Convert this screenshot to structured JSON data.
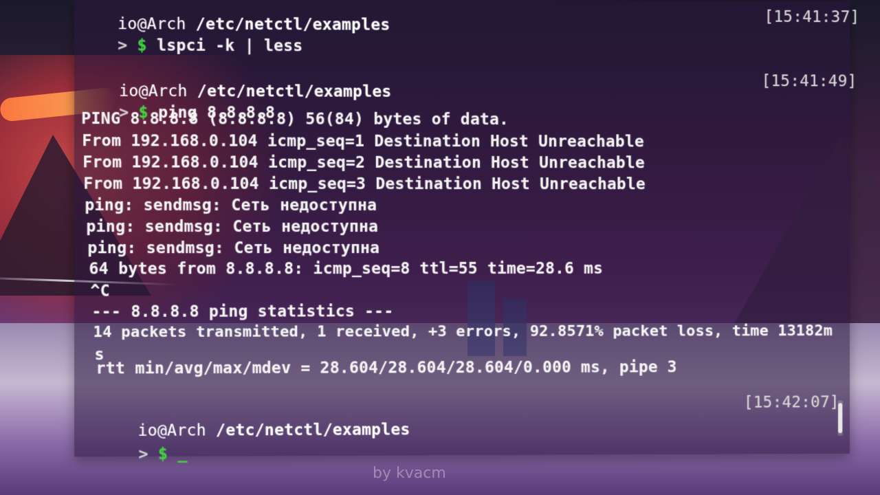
{
  "terminal": {
    "blocks": [
      {
        "user": "io@Arch",
        "path": "/etc/netctl/examples",
        "timestamp": "[15:41:37]",
        "prompt": ">",
        "dollar": "$",
        "command": "lspci -k | less"
      },
      {
        "user": "io@Arch",
        "path": "/etc/netctl/examples",
        "timestamp": "[15:41:49]",
        "prompt": ">",
        "dollar": "$",
        "command": "ping 8.8.8.8"
      }
    ],
    "output": [
      "PING 8.8.8.8 (8.8.8.8) 56(84) bytes of data.",
      "From 192.168.0.104 icmp_seq=1 Destination Host Unreachable",
      "From 192.168.0.104 icmp_seq=2 Destination Host Unreachable",
      "From 192.168.0.104 icmp_seq=3 Destination Host Unreachable",
      "ping: sendmsg: Сеть недоступна",
      "ping: sendmsg: Сеть недоступна",
      "ping: sendmsg: Сеть недоступна",
      "64 bytes from 8.8.8.8: icmp_seq=8 ttl=55 time=28.6 ms",
      "^C",
      "--- 8.8.8.8 ping statistics ---",
      "14 packets transmitted, 1 received, +3 errors, 92.8571% packet loss, time 13182m",
      "s",
      "rtt min/avg/max/mdev = 28.604/28.604/28.604/0.000 ms, pipe 3"
    ],
    "final": {
      "user": "io@Arch",
      "path": "/etc/netctl/examples",
      "timestamp": "[15:42:07]",
      "prompt": ">",
      "dollar": "$",
      "cursor": "_"
    }
  },
  "watermark": "by kvacm",
  "colors": {
    "prompt_dollar": "#38d838",
    "text": "#f4f4f4",
    "terminal_bg": "rgba(40,20,60,0.55)"
  }
}
